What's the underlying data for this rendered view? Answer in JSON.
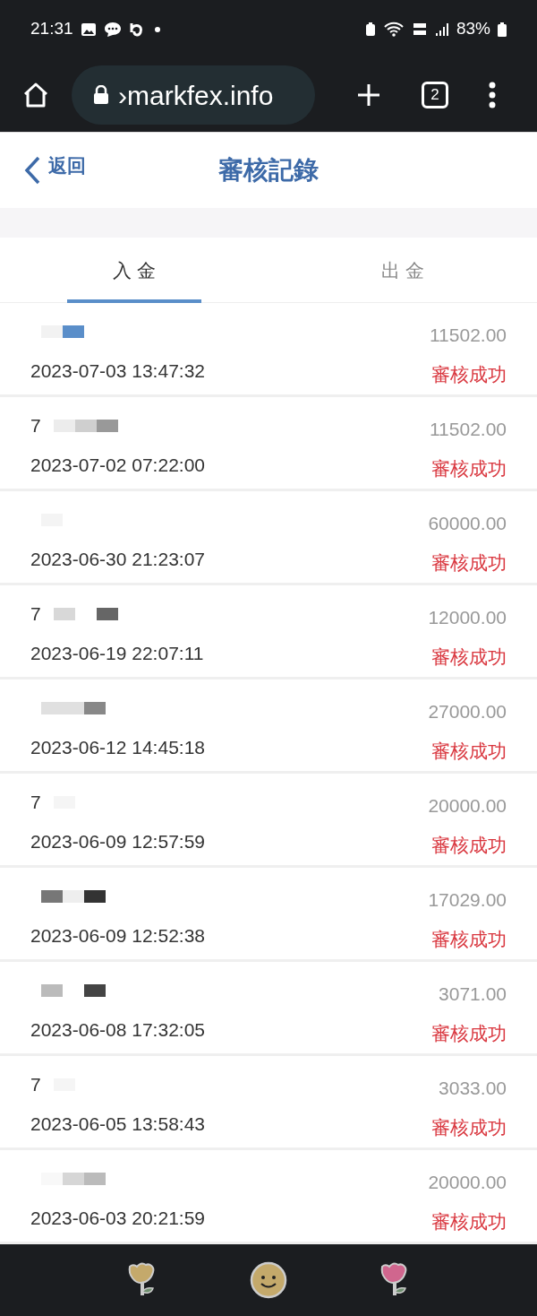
{
  "status_bar": {
    "time": "21:31",
    "battery": "83%"
  },
  "browser": {
    "url": "›markfex.info",
    "tab_count": "2"
  },
  "header": {
    "back": "返回",
    "title": "審核記錄"
  },
  "tabs": [
    {
      "label": "入 金",
      "selected": true
    },
    {
      "label": "出 金",
      "selected": false
    }
  ],
  "records": [
    {
      "amount": "11502.00",
      "time": "2023-07-03 13:47:32",
      "status": "審核成功"
    },
    {
      "account": "7",
      "amount": "11502.00",
      "time": "2023-07-02 07:22:00",
      "status": "審核成功"
    },
    {
      "amount": "60000.00",
      "time": "2023-06-30 21:23:07",
      "status": "審核成功"
    },
    {
      "account": "7",
      "amount": "12000.00",
      "time": "2023-06-19 22:07:11",
      "status": "審核成功"
    },
    {
      "amount": "27000.00",
      "time": "2023-06-12 14:45:18",
      "status": "審核成功"
    },
    {
      "account": "7",
      "amount": "20000.00",
      "time": "2023-06-09 12:57:59",
      "status": "審核成功"
    },
    {
      "amount": "17029.00",
      "time": "2023-06-09 12:52:38",
      "status": "審核成功"
    },
    {
      "amount": "3071.00",
      "time": "2023-06-08 17:32:05",
      "status": "審核成功"
    },
    {
      "account": "7",
      "amount": "3033.00",
      "time": "2023-06-05 13:58:43",
      "status": "審核成功"
    },
    {
      "amount": "20000.00",
      "time": "2023-06-03 20:21:59",
      "status": "審核成功"
    }
  ]
}
